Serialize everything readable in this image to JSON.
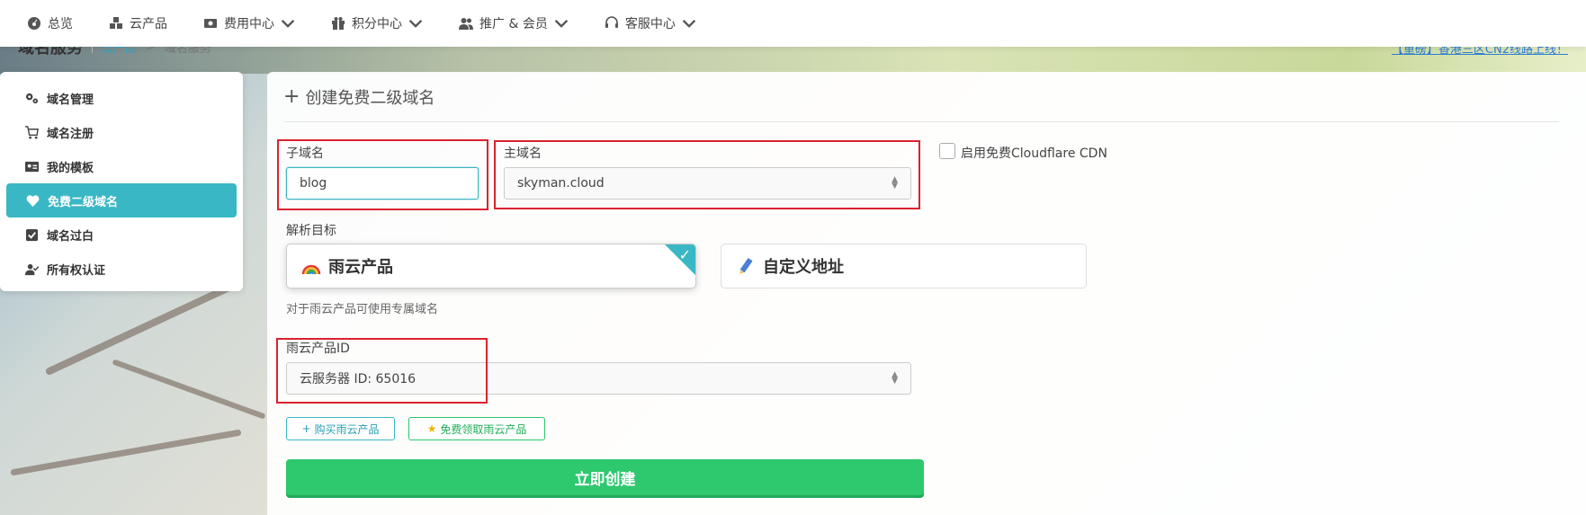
{
  "nav": {
    "items": [
      {
        "label": "总览",
        "icon": "dashboard-icon",
        "dropdown": false
      },
      {
        "label": "云产品",
        "icon": "cubes-icon",
        "dropdown": false
      },
      {
        "label": "费用中心",
        "icon": "money-icon",
        "dropdown": true
      },
      {
        "label": "积分中心",
        "icon": "gift-icon",
        "dropdown": true
      },
      {
        "label": "推广 & 会员",
        "icon": "users-icon",
        "dropdown": true
      },
      {
        "label": "客服中心",
        "icon": "headset-icon",
        "dropdown": true
      }
    ]
  },
  "breadcrumb": {
    "title": "域名服务",
    "link": "云产品",
    "current": "域名服务"
  },
  "notice": "【重磅】香港三区CN2线路上线！",
  "sidebar": {
    "items": [
      {
        "label": "域名管理",
        "icon": "cogs-icon"
      },
      {
        "label": "域名注册",
        "icon": "cart-icon"
      },
      {
        "label": "我的模板",
        "icon": "id-card-icon"
      },
      {
        "label": "免费二级域名",
        "icon": "heart-icon",
        "active": true
      },
      {
        "label": "域名过白",
        "icon": "check-square-icon"
      },
      {
        "label": "所有权认证",
        "icon": "user-check-icon"
      }
    ]
  },
  "form": {
    "header": "创建免费二级域名",
    "subdomain_label": "子域名",
    "subdomain_value": "blog",
    "main_domain_label": "主域名",
    "main_domain_value": "skyman.cloud",
    "cdn_label": "启用免费Cloudflare CDN",
    "cdn_checked": false,
    "target_label": "解析目标",
    "target_options": [
      {
        "label": "雨云产品",
        "icon": "rainbow-icon",
        "selected": true
      },
      {
        "label": "自定义地址",
        "icon": "pen-icon",
        "selected": false
      }
    ],
    "target_hint": "对于雨云产品可使用专属域名",
    "product_id_label": "雨云产品ID",
    "product_id_value": "云服务器 ID: 65016",
    "buy_button": "购买雨云产品",
    "free_button": "免费领取雨云产品",
    "create_button": "立即创建"
  },
  "colors": {
    "accent": "#3ab7c4",
    "success": "#2ec86f",
    "highlight_box": "#d9232e"
  }
}
